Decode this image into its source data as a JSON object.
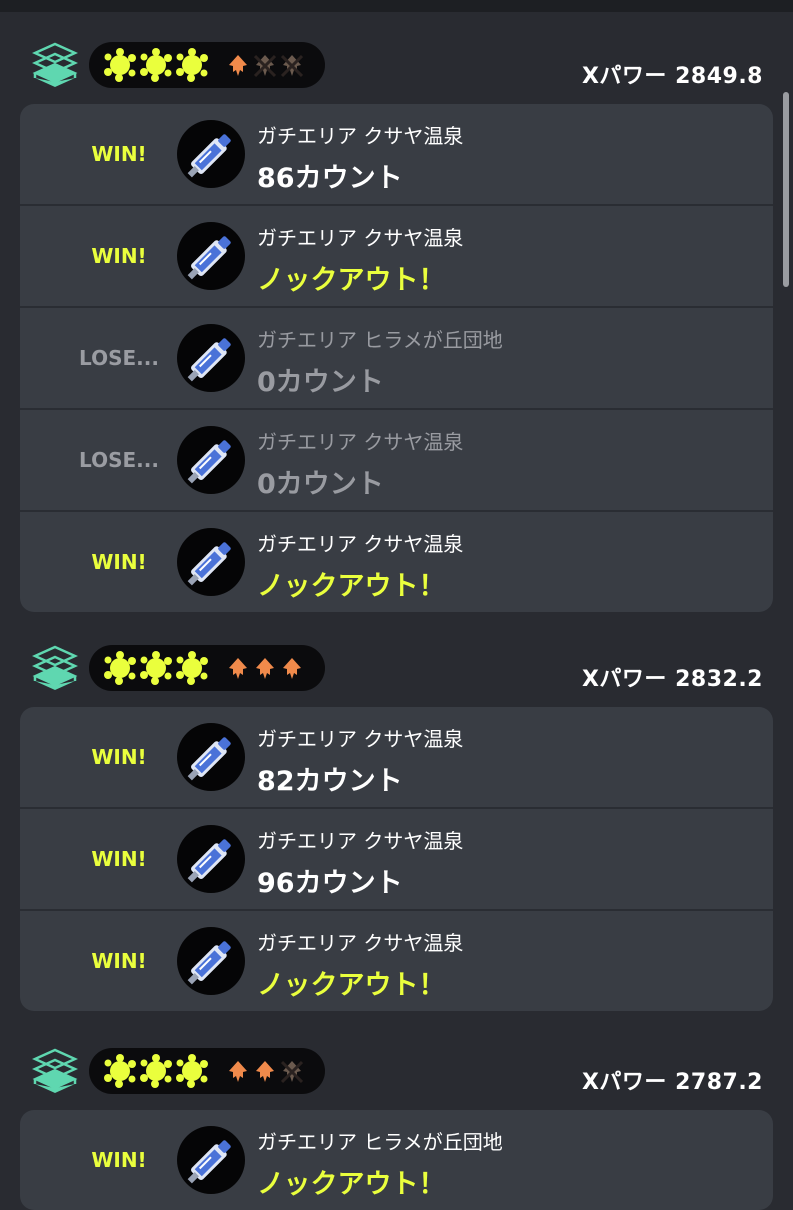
{
  "colors": {
    "background": "#292b31",
    "card": "#393d44",
    "win": "#eaff3d",
    "lose": "#9a9ca2",
    "splat": "#eaff3d",
    "squid": "#f08a4b",
    "rank_icon": "#5fd7b0"
  },
  "icons": {
    "rank": "layered-stack-icon",
    "win_mark": "yellow-splat-icon",
    "lose_mark": "orange-squid-icon",
    "lost_mark": "crossed-squid-icon",
    "weapon": "weapon-syringe-icon"
  },
  "groups": [
    {
      "xpower": "Xパワー 2849.8",
      "wins_shown": 3,
      "squids": [
        "orange",
        "crossed",
        "crossed"
      ],
      "rows": [
        {
          "result": "WIN!",
          "outcome": "win",
          "stage": "ガチエリア クサヤ温泉",
          "score": "86カウント"
        },
        {
          "result": "WIN!",
          "outcome": "win",
          "stage": "ガチエリア クサヤ温泉",
          "score": "ノックアウト！"
        },
        {
          "result": "LOSE...",
          "outcome": "lose",
          "stage": "ガチエリア ヒラメが丘団地",
          "score": "0カウント"
        },
        {
          "result": "LOSE...",
          "outcome": "lose",
          "stage": "ガチエリア クサヤ温泉",
          "score": "0カウント"
        },
        {
          "result": "WIN!",
          "outcome": "win",
          "stage": "ガチエリア クサヤ温泉",
          "score": "ノックアウト！"
        }
      ]
    },
    {
      "xpower": "Xパワー 2832.2",
      "wins_shown": 3,
      "squids": [
        "orange",
        "orange",
        "orange"
      ],
      "rows": [
        {
          "result": "WIN!",
          "outcome": "win",
          "stage": "ガチエリア クサヤ温泉",
          "score": "82カウント"
        },
        {
          "result": "WIN!",
          "outcome": "win",
          "stage": "ガチエリア クサヤ温泉",
          "score": "96カウント"
        },
        {
          "result": "WIN!",
          "outcome": "win",
          "stage": "ガチエリア クサヤ温泉",
          "score": "ノックアウト！"
        }
      ]
    },
    {
      "xpower": "Xパワー 2787.2",
      "wins_shown": 3,
      "squids": [
        "orange",
        "orange",
        "crossed"
      ],
      "rows": [
        {
          "result": "WIN!",
          "outcome": "win",
          "stage": "ガチエリア ヒラメが丘団地",
          "score": "ノックアウト！"
        }
      ]
    }
  ]
}
